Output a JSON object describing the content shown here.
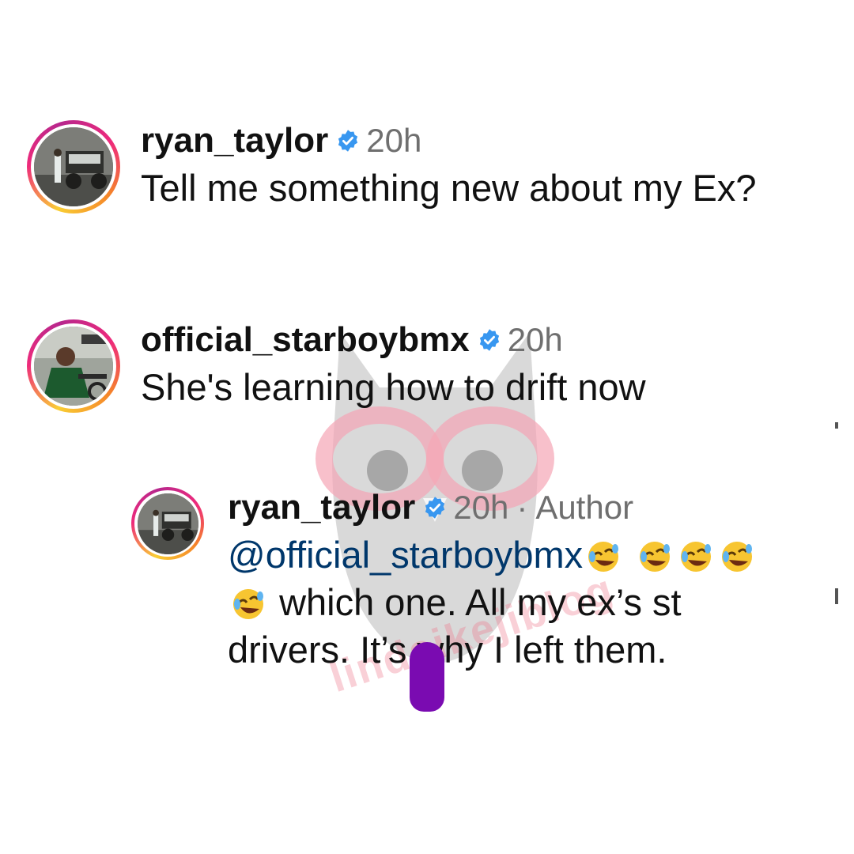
{
  "comments": [
    {
      "username": "ryan_taylor",
      "time": "20h",
      "text": "Tell me something new about my Ex?"
    },
    {
      "username": "official_starboybmx",
      "time": "20h",
      "text": "She's learning how to drift now"
    },
    {
      "username": "ryan_taylor",
      "time": "20h",
      "separator": "·",
      "badge": "Author",
      "mention": "@official_starboybmx",
      "text_part1": "which one. All my ex’s s",
      "text_part2": "t drivers. It’s why I left them."
    }
  ],
  "watermark": {
    "text": "lindaikejiblog"
  },
  "icons": {
    "verified": "verified-badge-icon",
    "emoji": "rolling-on-floor-laughing-emoji"
  },
  "colors": {
    "verified_blue": "#3897f0",
    "mention_blue": "#00376b",
    "meta_gray": "#6f6f6f",
    "censor_purple": "#7a0bb1"
  }
}
